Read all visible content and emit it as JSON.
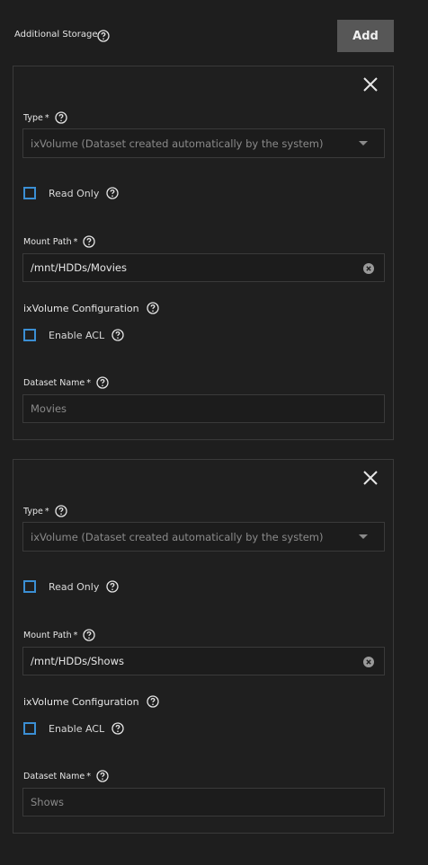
{
  "header": {
    "title": "Additional Storage",
    "add_label": "Add"
  },
  "cards": [
    {
      "type_label": "Type",
      "type_value": "ixVolume (Dataset created automatically by the system)",
      "read_only_label": "Read Only",
      "mount_path_label": "Mount Path",
      "mount_path_value": "/mnt/HDDs/Movies",
      "ixvolume_config_label": "ixVolume Configuration",
      "enable_acl_label": "Enable ACL",
      "dataset_name_label": "Dataset Name",
      "dataset_name_value": "Movies"
    },
    {
      "type_label": "Type",
      "type_value": "ixVolume (Dataset created automatically by the system)",
      "read_only_label": "Read Only",
      "mount_path_label": "Mount Path",
      "mount_path_value": "/mnt/HDDs/Shows",
      "ixvolume_config_label": "ixVolume Configuration",
      "enable_acl_label": "Enable ACL",
      "dataset_name_label": "Dataset Name",
      "dataset_name_value": "Shows"
    }
  ],
  "required_marker": "*",
  "colors": {
    "background": "#1e1e1e",
    "checkbox_border": "#3b8fd4",
    "add_button": "#575757"
  }
}
